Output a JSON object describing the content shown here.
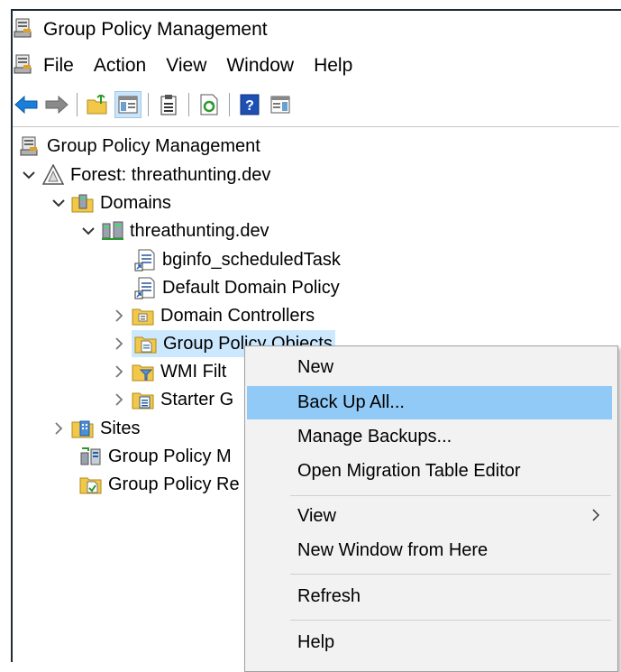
{
  "window": {
    "title": "Group Policy Management"
  },
  "menubar": [
    "File",
    "Action",
    "View",
    "Window",
    "Help"
  ],
  "tree": {
    "root": "Group Policy Management",
    "forest": "Forest: threathunting.dev",
    "domains": "Domains",
    "domain": "threathunting.dev",
    "gpo_scheduled": "bginfo_scheduledTask",
    "gpo_default": "Default Domain Policy",
    "ou_dc": "Domain Controllers",
    "gpo_objects": "Group Policy Objects",
    "wmi": "WMI Filt",
    "starter": "Starter G",
    "sites": "Sites",
    "modeling": "Group Policy M",
    "results": "Group Policy Re"
  },
  "context_menu": {
    "new": "New",
    "backup_all": "Back Up All...",
    "manage_backups": "Manage Backups...",
    "migration": "Open Migration Table Editor",
    "view": "View",
    "new_window": "New Window from Here",
    "refresh": "Refresh",
    "help": "Help"
  },
  "colors": {
    "highlight": "#91c9f7",
    "selection": "#cce8ff",
    "menu_bg": "#f2f2f2"
  }
}
